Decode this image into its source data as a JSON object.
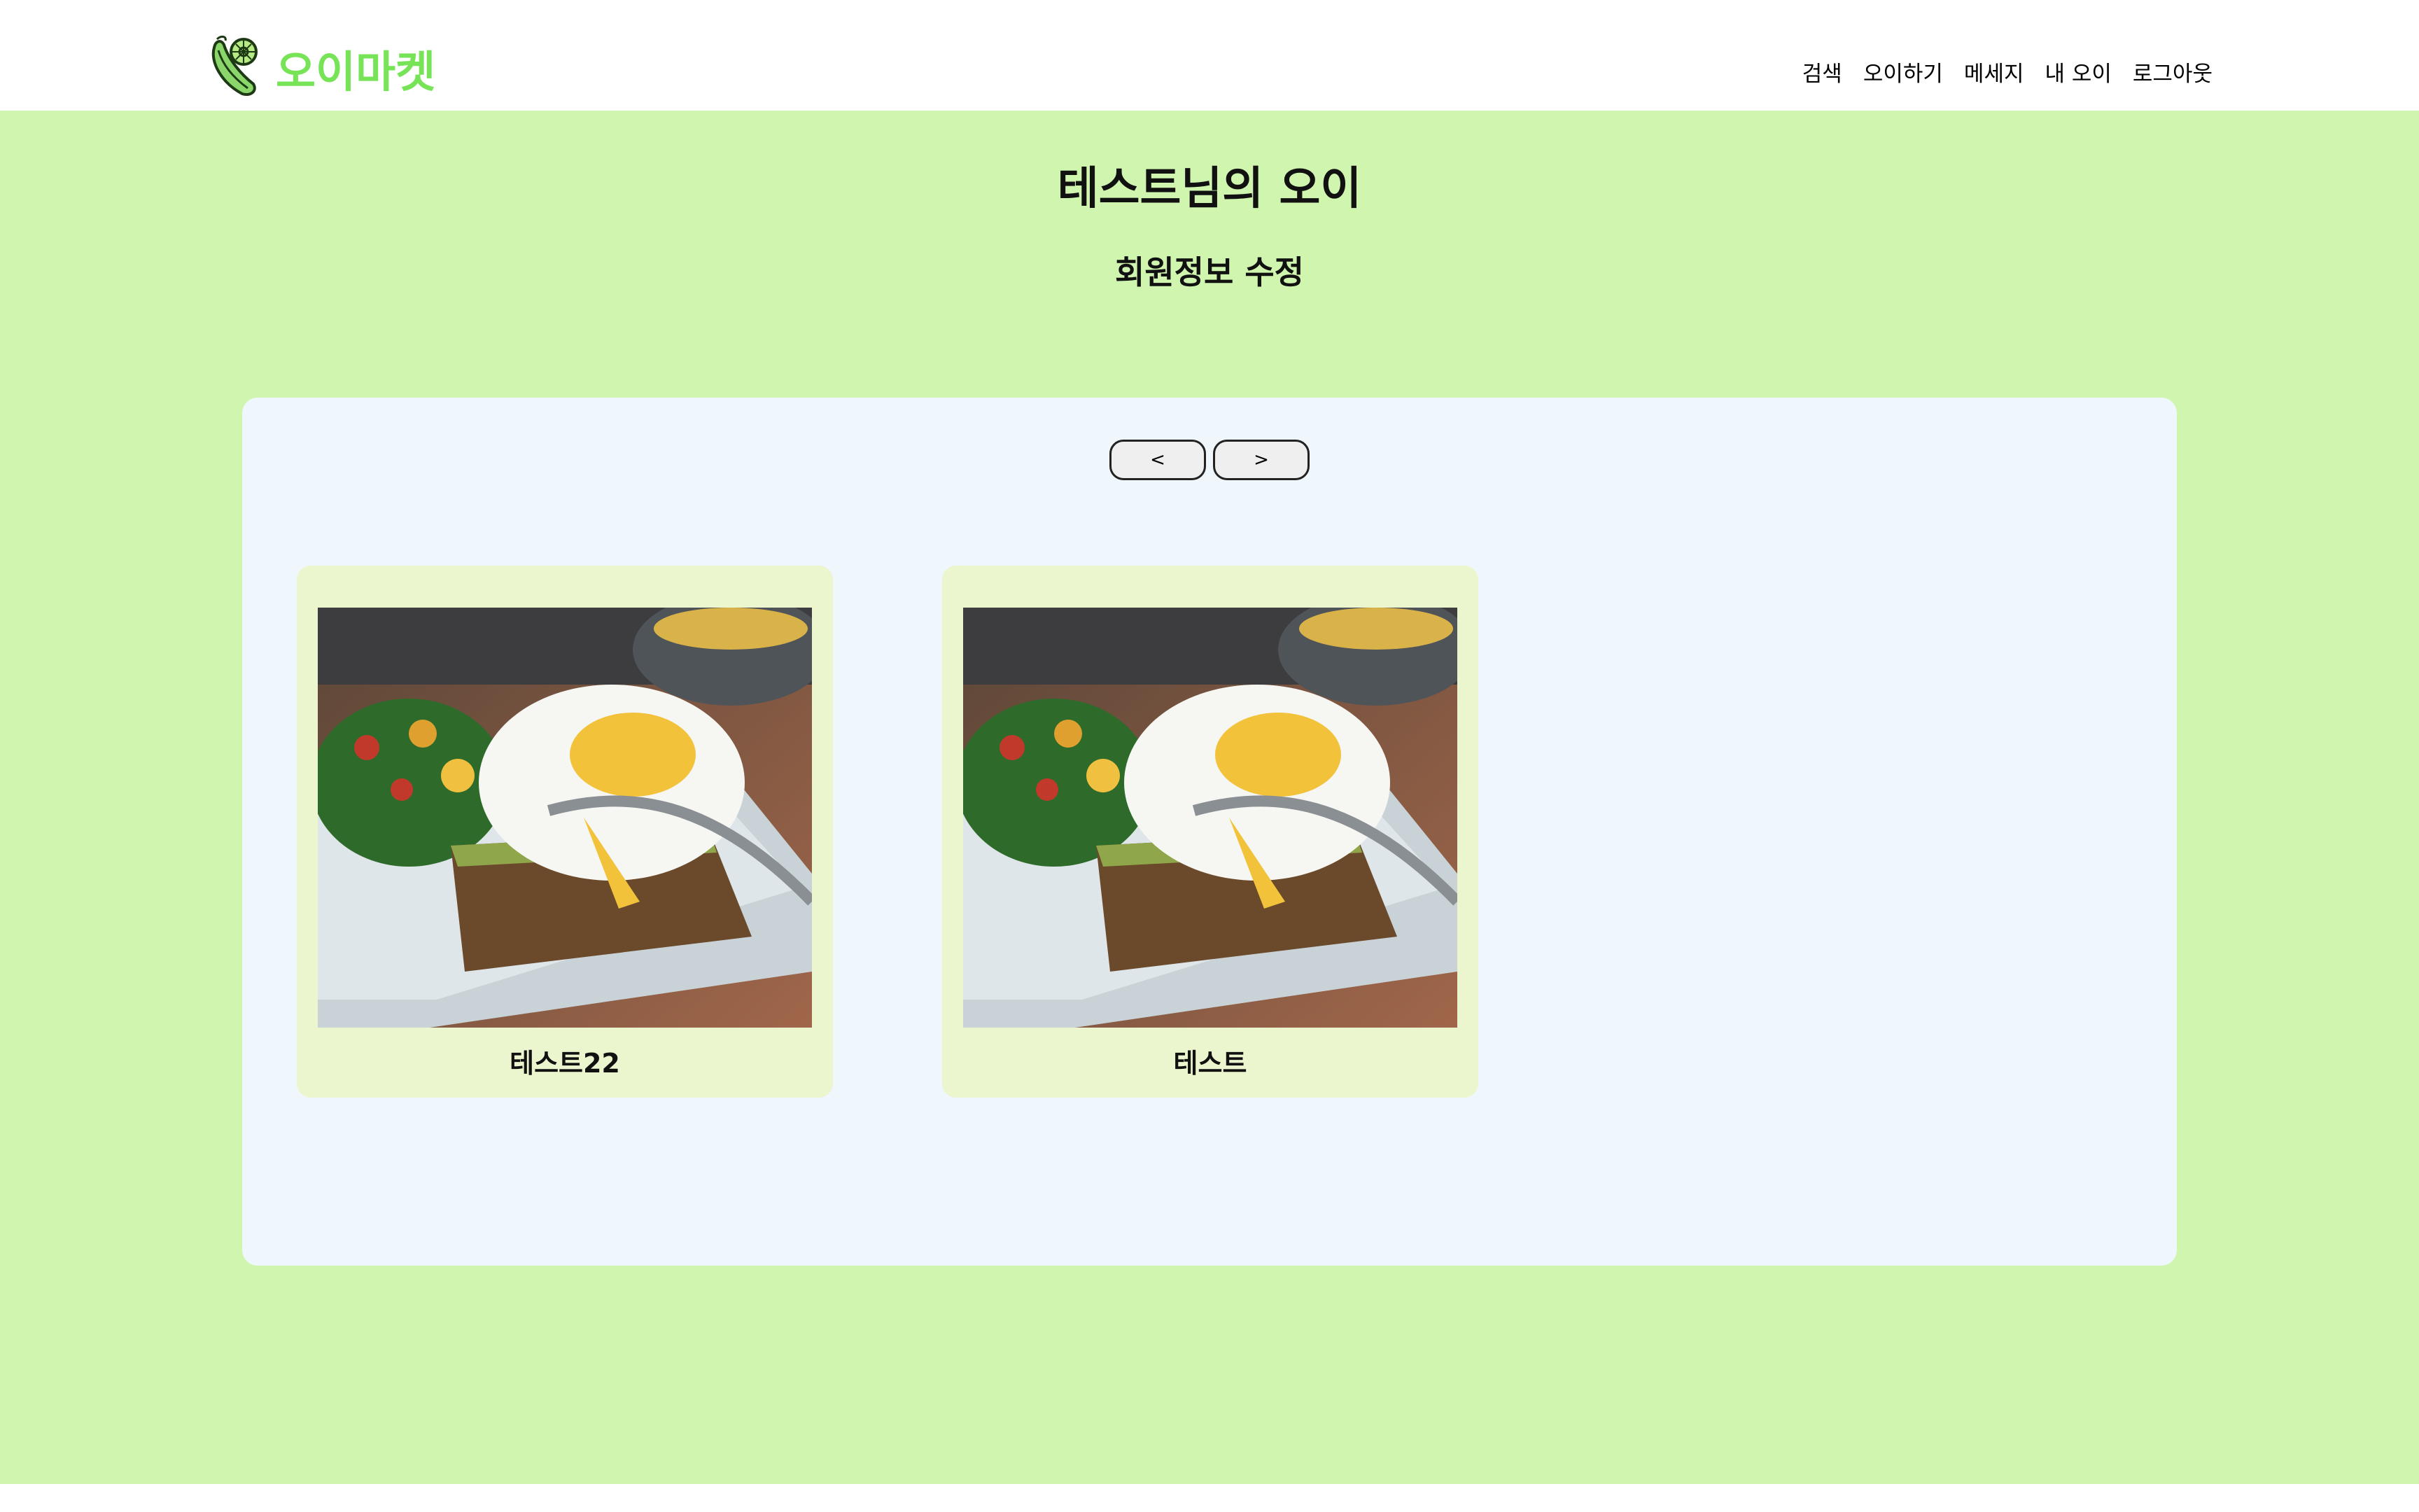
{
  "brand": {
    "name": "오이마켓",
    "logo_icon": "cucumber-icon",
    "color": "#77e357"
  },
  "nav": {
    "items": [
      {
        "label": "검색"
      },
      {
        "label": "오이하기"
      },
      {
        "label": "메세지"
      },
      {
        "label": "내 오이"
      },
      {
        "label": "로그아웃"
      }
    ]
  },
  "page": {
    "title": "테스트님의 오이",
    "edit_profile": "회원정보 수정"
  },
  "pager": {
    "prev_label": "<",
    "next_label": ">"
  },
  "products": [
    {
      "name": "테스트22",
      "image": "food-photo-poached-egg-toast"
    },
    {
      "name": "테스트",
      "image": "food-photo-poached-egg-toast"
    }
  ],
  "colors": {
    "background": "#cff5ae",
    "panel": "#eff6fc",
    "card": "#ebf6cf"
  }
}
